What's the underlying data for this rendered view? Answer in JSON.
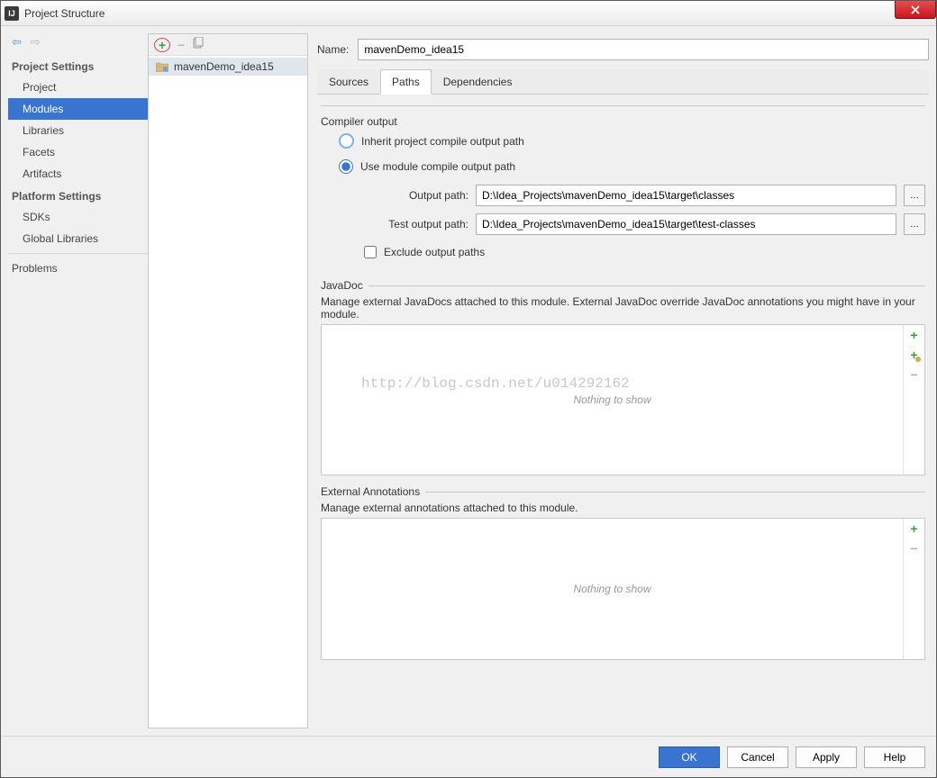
{
  "window": {
    "title": "Project Structure"
  },
  "sidebar": {
    "heading1": "Project Settings",
    "items1": [
      "Project",
      "Modules",
      "Libraries",
      "Facets",
      "Artifacts"
    ],
    "heading2": "Platform Settings",
    "items2": [
      "SDKs",
      "Global Libraries"
    ],
    "problems": "Problems"
  },
  "modulelist": {
    "items": [
      "mavenDemo_idea15"
    ]
  },
  "main": {
    "name_label": "Name:",
    "name_value": "mavenDemo_idea15",
    "tabs": [
      "Sources",
      "Paths",
      "Dependencies"
    ],
    "compiler": {
      "legend": "Compiler output",
      "inherit_label": "Inherit project compile output path",
      "use_module_label": "Use module compile output path",
      "output_label": "Output path:",
      "output_value": "D:\\Idea_Projects\\mavenDemo_idea15\\target\\classes",
      "test_label": "Test output path:",
      "test_value": "D:\\Idea_Projects\\mavenDemo_idea15\\target\\test-classes",
      "exclude_label": "Exclude output paths"
    },
    "javadoc": {
      "title": "JavaDoc",
      "desc": "Manage external JavaDocs attached to this module. External JavaDoc override JavaDoc annotations you might have in your module.",
      "empty": "Nothing to show"
    },
    "annotations": {
      "title": "External Annotations",
      "desc": "Manage external annotations attached to this module.",
      "empty": "Nothing to show"
    }
  },
  "footer": {
    "ok": "OK",
    "cancel": "Cancel",
    "apply": "Apply",
    "help": "Help"
  },
  "watermark": "http://blog.csdn.net/u014292162"
}
